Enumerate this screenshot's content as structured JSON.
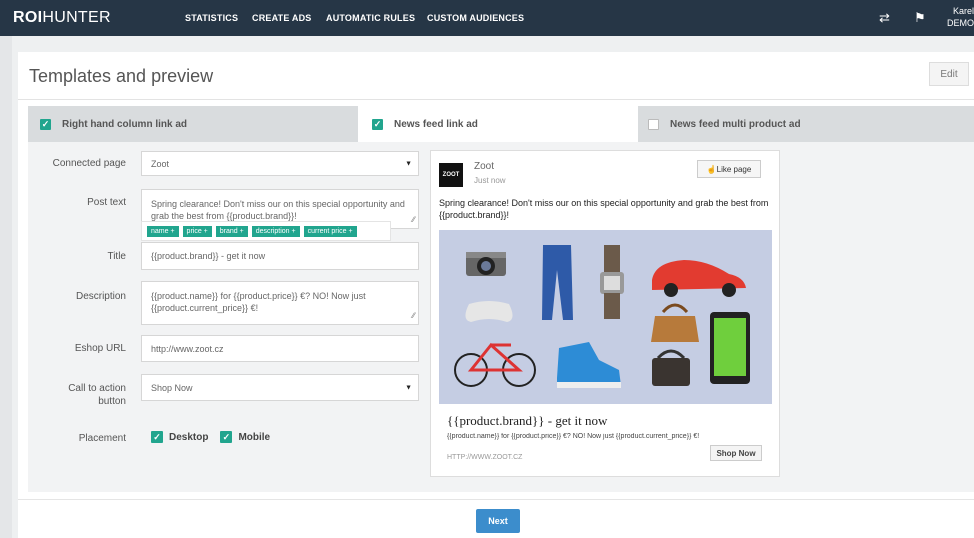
{
  "app": {
    "logo_bold": "ROI",
    "logo_light": "HUNTER"
  },
  "nav": {
    "items": [
      "STATISTICS",
      "CREATE ADS",
      "AUTOMATIC RULES",
      "CUSTOM AUDIENCES"
    ]
  },
  "user": {
    "name": "Karel",
    "account": "DEMO"
  },
  "page": {
    "title": "Templates and preview",
    "edit_label": "Edit"
  },
  "tabs": [
    {
      "label": "Right hand column link ad",
      "checked": true
    },
    {
      "label": "News feed link ad",
      "checked": true
    },
    {
      "label": "News feed multi product ad",
      "checked": false
    }
  ],
  "form": {
    "connected_page": {
      "label": "Connected page",
      "value": "Zoot"
    },
    "post_text": {
      "label": "Post text",
      "value": "Spring clearance! Don't miss our on this special opportunity and grab the best from {{product.brand}}!"
    },
    "tags": [
      "name +",
      "price +",
      "brand +",
      "description +",
      "current price +"
    ],
    "title": {
      "label": "Title",
      "value": "{{product.brand}} - get it now"
    },
    "description": {
      "label": "Description",
      "value": "{{product.name}} for {{product.price}} €? NO! Now just {{product.current_price}} €!"
    },
    "eshop_url": {
      "label": "Eshop URL",
      "value": "http://www.zoot.cz"
    },
    "cta": {
      "label_line1": "Call to action",
      "label_line2": "button",
      "value": "Shop Now"
    },
    "placement": {
      "label": "Placement",
      "desktop": "Desktop",
      "mobile": "Mobile"
    }
  },
  "preview": {
    "logo_text": "ZOOT",
    "page_name": "Zoot",
    "time": "Just now",
    "like_label": "☝Like page",
    "post_text": "Spring clearance! Don't miss our on this special opportunity and grab the best from {{product.brand}}!",
    "title": "{{product.brand}} - get it now",
    "description": "{{product.name}} for {{product.price}} €? NO! Now just {{product.current_price}} €!",
    "url": "HTTP://WWW.ZOOT.CZ",
    "cta": "Shop Now"
  },
  "footer": {
    "next_label": "Next"
  },
  "colors": {
    "nav_bg": "#263646",
    "accent_green": "#21a58e",
    "primary_blue": "#3c8dcc"
  }
}
